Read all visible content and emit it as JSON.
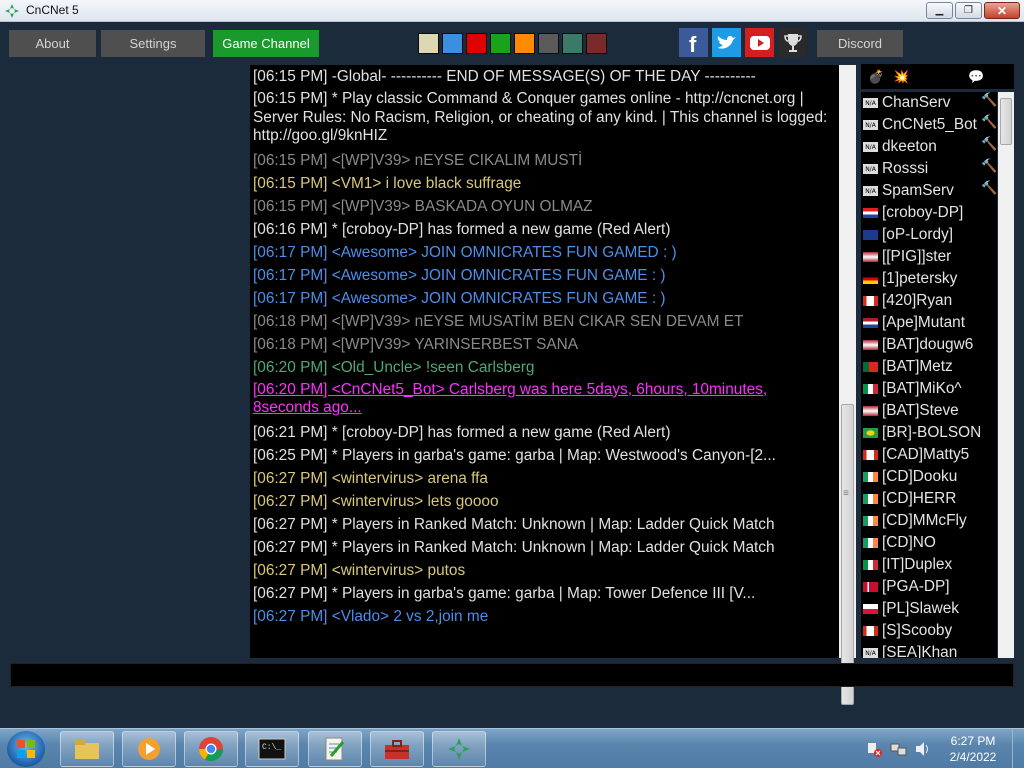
{
  "window": {
    "title": "CnCNet 5"
  },
  "toolbar": {
    "about": "About",
    "settings": "Settings",
    "game_channel": "Game Channel",
    "discord": "Discord",
    "color_swatches": [
      "#ddd8b4",
      "#3c8fe0",
      "#e00000",
      "#1aa21a",
      "#ff8a00",
      "#5a5a5a",
      "#3b7a68",
      "#7a2a2a"
    ],
    "social_icons": [
      "facebook-icon",
      "twitter-icon",
      "youtube-icon",
      "trophy-icon"
    ]
  },
  "chat": {
    "lines": [
      {
        "text": "[06:15 PM] -Global- ---------- END OF MESSAGE(S) OF THE DAY ----------",
        "color": "white"
      },
      {
        "text": "[06:15 PM] * Play classic Command & Conquer games online - http://cncnet.org | Server Rules: No Racism, Religion, or cheating of any kind. | This channel is logged: http://goo.gl/9knHIZ",
        "color": "white",
        "wrap": true
      },
      {
        "text": "[06:15 PM] <[WP]V39> nEYSE CIKALIM MUSTİ",
        "color": "grey"
      },
      {
        "text": "[06:15 PM] <VM1> i love black suffrage",
        "color": "yellow"
      },
      {
        "text": "[06:15 PM] <[WP]V39> BASKADA OYUN OLMAZ",
        "color": "grey"
      },
      {
        "text": "[06:16 PM] * [croboy-DP] has formed a new game (Red Alert)",
        "color": "white"
      },
      {
        "text": "[06:17 PM] <Awesome> JOIN OMNICRATES FUN GAMED : )",
        "color": "blue"
      },
      {
        "text": "[06:17 PM] <Awesome> JOIN OMNICRATES FUN GAME : )",
        "color": "blue"
      },
      {
        "text": "[06:17 PM] <Awesome> JOIN OMNICRATES FUN GAME : )",
        "color": "blue"
      },
      {
        "text": "[06:18 PM] <[WP]V39> nEYSE MUSATİM BEN CIKAR SEN DEVAM ET",
        "color": "grey"
      },
      {
        "text": "[06:18 PM] <[WP]V39> YARINSERBEST SANA",
        "color": "grey"
      },
      {
        "text": "[06:20 PM] <Old_Uncle> !seen Carlsberg",
        "color": "green"
      },
      {
        "text": "[06:20 PM] <CnCNet5_Bot> Carlsberg was here 5days, 6hours, 10minutes, 8seconds ago...",
        "color": "pink",
        "wrap": true
      },
      {
        "text": "[06:21 PM] * [croboy-DP] has formed a new game (Red Alert)",
        "color": "white"
      },
      {
        "text": "[06:25 PM] * Players in garba's game: garba | Map: Westwood's Canyon-[2...",
        "color": "white"
      },
      {
        "text": "[06:27 PM] <wintervirus> arena ffa",
        "color": "yellow"
      },
      {
        "text": "[06:27 PM] <wintervirus> lets goooo",
        "color": "yellow"
      },
      {
        "text": "[06:27 PM] * Players in Ranked Match: Unknown | Map: Ladder Quick Match",
        "color": "white"
      },
      {
        "text": "[06:27 PM] * Players in Ranked Match: Unknown | Map: Ladder Quick Match",
        "color": "white"
      },
      {
        "text": "[06:27 PM] <wintervirus> putos",
        "color": "yellow"
      },
      {
        "text": "[06:27 PM] * Players in garba's game: garba | Map: Tower Defence III [V...",
        "color": "white"
      },
      {
        "text": "[06:27 PM] <Vlado> 2 vs 2,join me",
        "color": "blue"
      }
    ]
  },
  "userlist": {
    "header_icons": [
      "bomb-icon",
      "explosion-icon",
      "eye-icon",
      "coin-icon",
      "chat-bubble-icon",
      "heart-icon"
    ],
    "users": [
      {
        "name": "ChanServ",
        "flag": "na",
        "op": true
      },
      {
        "name": "CnCNet5_Bot",
        "flag": "na",
        "op": true
      },
      {
        "name": "dkeeton",
        "flag": "na",
        "op": true
      },
      {
        "name": "Rosssi",
        "flag": "na",
        "op": true
      },
      {
        "name": "SpamServ",
        "flag": "na",
        "op": true
      },
      {
        "name": "[croboy-DP]",
        "flag": "hr",
        "op": false
      },
      {
        "name": "[oP-Lordy]",
        "flag": "gb",
        "op": false
      },
      {
        "name": "[[PIG]]ster",
        "flag": "us",
        "op": false
      },
      {
        "name": "[1]petersky",
        "flag": "de",
        "op": false
      },
      {
        "name": "[420]Ryan",
        "flag": "ca",
        "op": false
      },
      {
        "name": "[Ape]Mutant",
        "flag": "nl",
        "op": false
      },
      {
        "name": "[BAT]dougw6",
        "flag": "us",
        "op": false
      },
      {
        "name": "[BAT]Metz",
        "flag": "pt",
        "op": false
      },
      {
        "name": "[BAT]MiKo^",
        "flag": "it",
        "op": false
      },
      {
        "name": "[BAT]Steve",
        "flag": "us",
        "op": false
      },
      {
        "name": "[BR]-BOLSON",
        "flag": "br",
        "op": false
      },
      {
        "name": "[CAD]Matty5",
        "flag": "ca",
        "op": false
      },
      {
        "name": "[CD]Dooku",
        "flag": "ie",
        "op": false
      },
      {
        "name": "[CD]HERR",
        "flag": "ie",
        "op": false
      },
      {
        "name": "[CD]MMcFly",
        "flag": "ie",
        "op": false
      },
      {
        "name": "[CD]NO",
        "flag": "ie",
        "op": false
      },
      {
        "name": "[IT]Duplex",
        "flag": "it",
        "op": false
      },
      {
        "name": "[PGA-DP]",
        "flag": "dk",
        "op": false
      },
      {
        "name": "[PL]Slawek",
        "flag": "pl",
        "op": false
      },
      {
        "name": "[S]Scooby",
        "flag": "ca",
        "op": false
      },
      {
        "name": "[SEA]Khan",
        "flag": "na",
        "op": false
      }
    ],
    "na_label": "N/A"
  },
  "taskbar": {
    "apps": [
      "windows-explorer-icon",
      "media-player-icon",
      "chrome-icon",
      "command-prompt-icon",
      "notepad-icon",
      "toolbox-icon",
      "cncnet-icon"
    ],
    "time": "6:27 PM",
    "date": "2/4/2022"
  }
}
